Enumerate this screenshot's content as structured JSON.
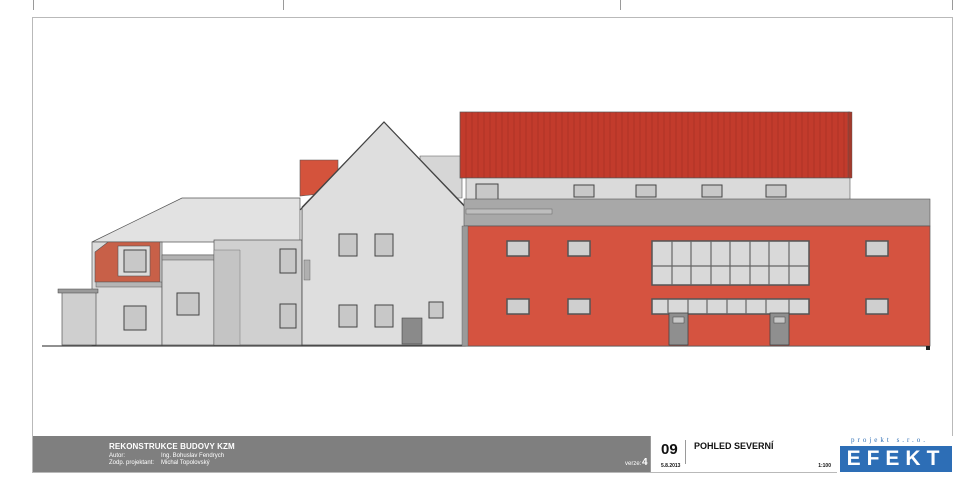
{
  "title_block": {
    "project_name": "REKONSTRUKCE BUDOVY KZM",
    "author_label": "Autor:",
    "author_value": "Ing. Bohuslav Fendrych",
    "lead_label": "Zodp. projektant:",
    "lead_value": "Michal Topolovský",
    "version_label": "verze:",
    "version_value": "4",
    "sheet_number": "09",
    "sheet_title": "POHLED SEVERNÍ",
    "date": "5.8.2013",
    "scale": "1:100"
  },
  "logo": {
    "tagline": "projekt s.r.o.",
    "name": "EFEKT"
  },
  "colors": {
    "roof_red": "#c0392b",
    "facade_red": "#d9533f",
    "wall_grey": "#d6d6d6",
    "dark_grey": "#7f7f7f",
    "logo_blue": "#2d6eb6"
  }
}
